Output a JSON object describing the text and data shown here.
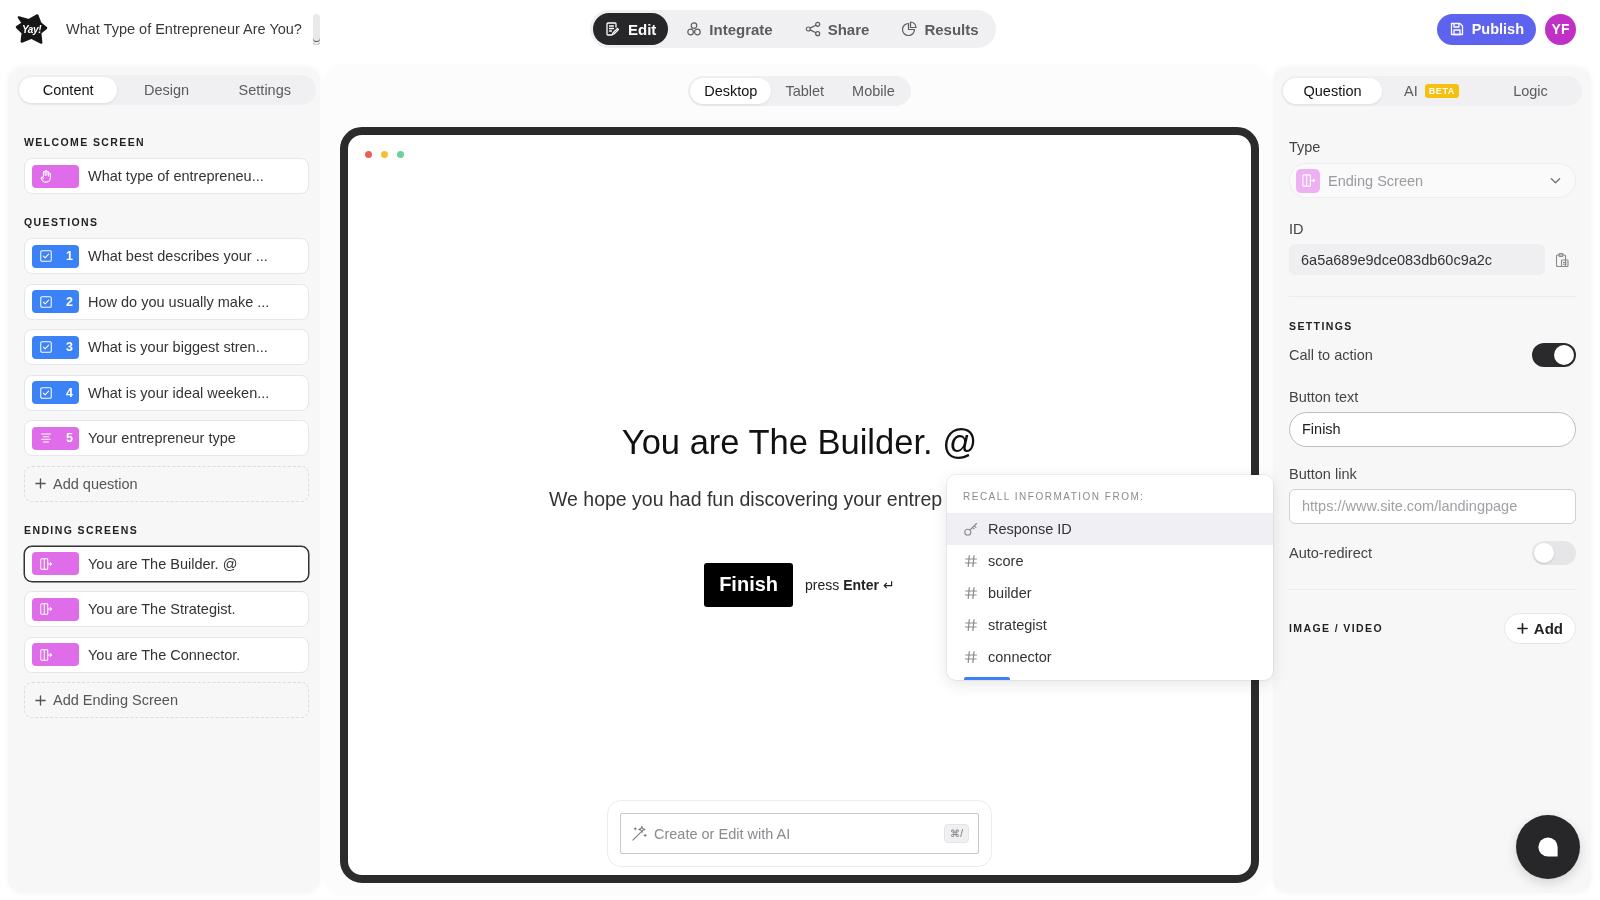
{
  "header": {
    "logo": "Yay!",
    "title": "What Type of Entrepreneur Are You?",
    "modes": [
      {
        "label": "Edit",
        "selected": true
      },
      {
        "label": "Integrate",
        "selected": false
      },
      {
        "label": "Share",
        "selected": false
      },
      {
        "label": "Results",
        "selected": false
      }
    ],
    "publish_button": "Publish",
    "avatar": "YF"
  },
  "left_panel": {
    "tabs": [
      {
        "label": "Content",
        "selected": true
      },
      {
        "label": "Design",
        "selected": false
      },
      {
        "label": "Settings",
        "selected": false
      }
    ],
    "sections": [
      {
        "heading": "WELCOME SCREEN",
        "items": [
          {
            "kind": "welcome",
            "color": "#df6ce9",
            "label": "What type of entrepreneu...",
            "selected": false
          }
        ]
      },
      {
        "heading": "QUESTIONS",
        "items": [
          {
            "kind": "question",
            "color": "#3b82f6",
            "number": "1",
            "label": "What best describes your ...",
            "selected": false
          },
          {
            "kind": "question",
            "color": "#3b82f6",
            "number": "2",
            "label": "How do you usually make ...",
            "selected": false
          },
          {
            "kind": "question",
            "color": "#3b82f6",
            "number": "3",
            "label": "What is your biggest stren...",
            "selected": false
          },
          {
            "kind": "question",
            "color": "#3b82f6",
            "number": "4",
            "label": "What is your ideal weeken...",
            "selected": false
          },
          {
            "kind": "statement",
            "color": "#df6ce9",
            "number": "5",
            "label": "Your entrepreneur type",
            "selected": false
          }
        ],
        "add_button": "Add question"
      },
      {
        "heading": "ENDING SCREENS",
        "items": [
          {
            "kind": "ending",
            "color": "#df6ce9",
            "label": "You are The Builder. @",
            "selected": true
          },
          {
            "kind": "ending",
            "color": "#df6ce9",
            "label": "You are The Strategist.",
            "selected": false
          },
          {
            "kind": "ending",
            "color": "#df6ce9",
            "label": "You are The Connector.",
            "selected": false
          }
        ],
        "add_button": "Add Ending Screen"
      }
    ]
  },
  "preview": {
    "device_tabs": [
      {
        "label": "Desktop",
        "selected": true
      },
      {
        "label": "Tablet",
        "selected": false
      },
      {
        "label": "Mobile",
        "selected": false
      }
    ],
    "heading": "You are The Builder. @",
    "subtitle": "We hope you had fun discovering your entrep",
    "button": "Finish",
    "hint": "press **Enter** ↵",
    "recall_menu": {
      "heading": "RECALL INFORMATION FROM:",
      "items": [
        {
          "kind": "key",
          "label": "Response ID",
          "selected": true
        },
        {
          "kind": "variable",
          "label": "score",
          "selected": false
        },
        {
          "kind": "variable",
          "label": "builder",
          "selected": false
        },
        {
          "kind": "variable",
          "label": "strategist",
          "selected": false
        },
        {
          "kind": "variable",
          "label": "connector",
          "selected": false
        }
      ]
    },
    "ai_bar": {
      "placeholder": "Create or Edit with AI",
      "shortcut": "⌘/"
    }
  },
  "right_panel": {
    "tabs": [
      {
        "label": "Question",
        "selected": true
      },
      {
        "label": "AI",
        "badge": "BETA",
        "selected": false
      },
      {
        "label": "Logic",
        "selected": false
      }
    ],
    "type_label": "Type",
    "type_value": "Ending Screen",
    "id_label": "ID",
    "id_value": "6a5a689e9dce083db60c9a2c",
    "settings_heading": "SETTINGS",
    "settings": [
      {
        "kind": "toggle",
        "label": "Call to action",
        "on": true
      },
      {
        "kind": "pill",
        "label": "Button text",
        "value": "Finish"
      },
      {
        "kind": "field",
        "label": "Button link",
        "placeholder": "https://www.site.com/landingpage"
      },
      {
        "kind": "toggle",
        "label": "Auto-redirect",
        "on": false
      }
    ],
    "media_heading": "IMAGE / VIDEO",
    "add_button": "Add"
  }
}
